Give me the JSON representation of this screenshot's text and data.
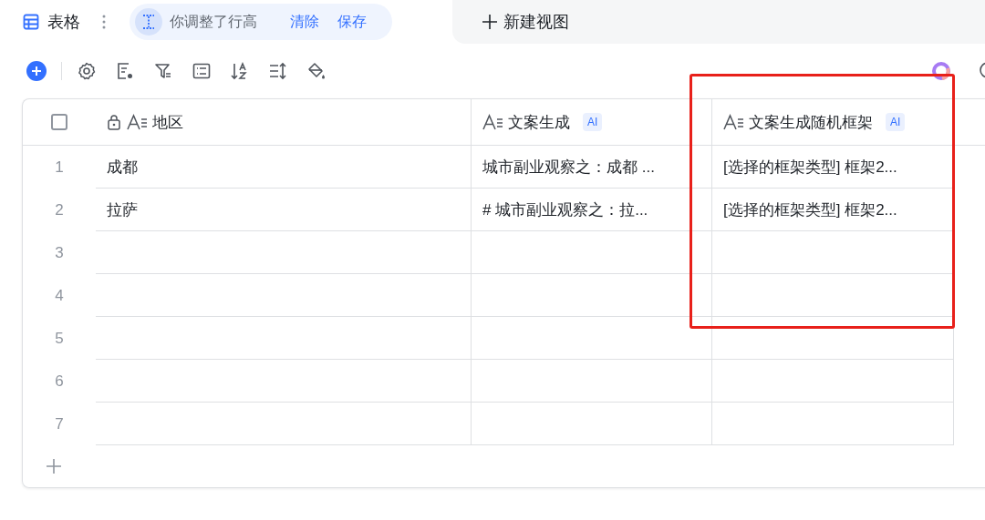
{
  "view_tab": {
    "label": "表格",
    "selected": true
  },
  "hint": {
    "text": "你调整了行高",
    "actions": [
      "清除",
      "保存"
    ]
  },
  "new_view": {
    "label": "新建视图"
  },
  "table": {
    "select_all": {
      "checked": false
    },
    "columns": [
      {
        "title": "地区",
        "locked": true,
        "ai": false
      },
      {
        "title": "文案生成",
        "locked": false,
        "ai": true,
        "badge": "AI"
      },
      {
        "title": "文案生成随机框架",
        "locked": false,
        "ai": true,
        "badge": "AI"
      }
    ],
    "rows": [
      {
        "index": "1",
        "cells": [
          "成都",
          "城市副业观察之：成都 ...",
          "[选择的框架类型] 框架2..."
        ]
      },
      {
        "index": "2",
        "cells": [
          "拉萨",
          "# 城市副业观察之：拉...",
          "[选择的框架类型] 框架2..."
        ]
      },
      {
        "index": "3",
        "cells": []
      },
      {
        "index": "4",
        "cells": []
      },
      {
        "index": "5",
        "cells": []
      },
      {
        "index": "6",
        "cells": []
      },
      {
        "index": "7",
        "cells": []
      }
    ]
  },
  "annotation": {
    "kind": "highlight"
  }
}
